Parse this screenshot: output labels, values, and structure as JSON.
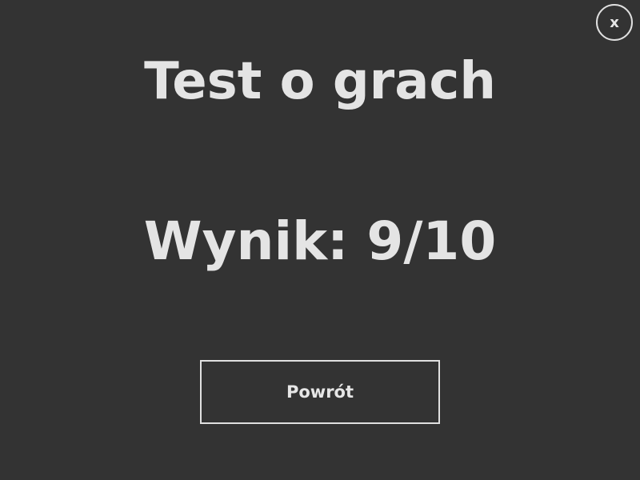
{
  "window": {
    "background": "#333333",
    "text_color": "#e6e6e6"
  },
  "close_button": {
    "label": "x"
  },
  "title": "Test o grach",
  "score": {
    "text": "Wynik: 9/10"
  },
  "back_button": {
    "label": "Powrót"
  }
}
